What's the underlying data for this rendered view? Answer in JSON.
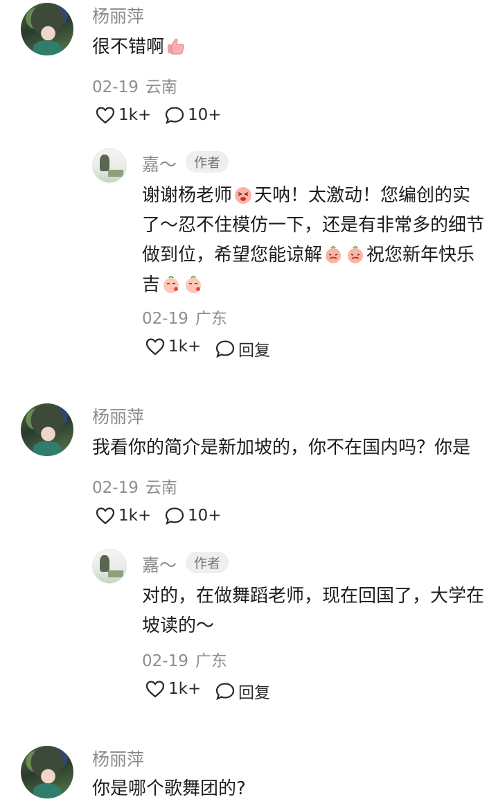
{
  "comments": [
    {
      "username": "杨丽萍",
      "text_lines": [
        "很不错啊"
      ],
      "date": "02-19",
      "region": "云南",
      "likes": "1k+",
      "replies": "10+",
      "reply": {
        "username": "嘉～",
        "badge": "作者",
        "text_lines": [
          "谢谢杨老师",
          "天呐！太激动！您编创的实",
          "了～忍不住模仿一下，还是有非常多的细节",
          "做到位，希望您能谅解",
          "祝您新年快乐",
          "吉"
        ],
        "date": "02-19",
        "region": "广东",
        "likes": "1k+",
        "reply_label": "回复"
      }
    },
    {
      "username": "杨丽萍",
      "text_lines": [
        "我看你的简介是新加坡的，你不在国内吗？你是"
      ],
      "date": "02-19",
      "region": "云南",
      "likes": "1k+",
      "replies": "10+",
      "reply": {
        "username": "嘉～",
        "badge": "作者",
        "text_lines": [
          "对的，在做舞蹈老师，现在回国了，大学在",
          "坡读的～"
        ],
        "date": "02-19",
        "region": "广东",
        "likes": "1k+",
        "reply_label": "回复"
      }
    },
    {
      "username": "杨丽萍",
      "text_lines": [
        "你是哪个歌舞团的?"
      ]
    }
  ]
}
